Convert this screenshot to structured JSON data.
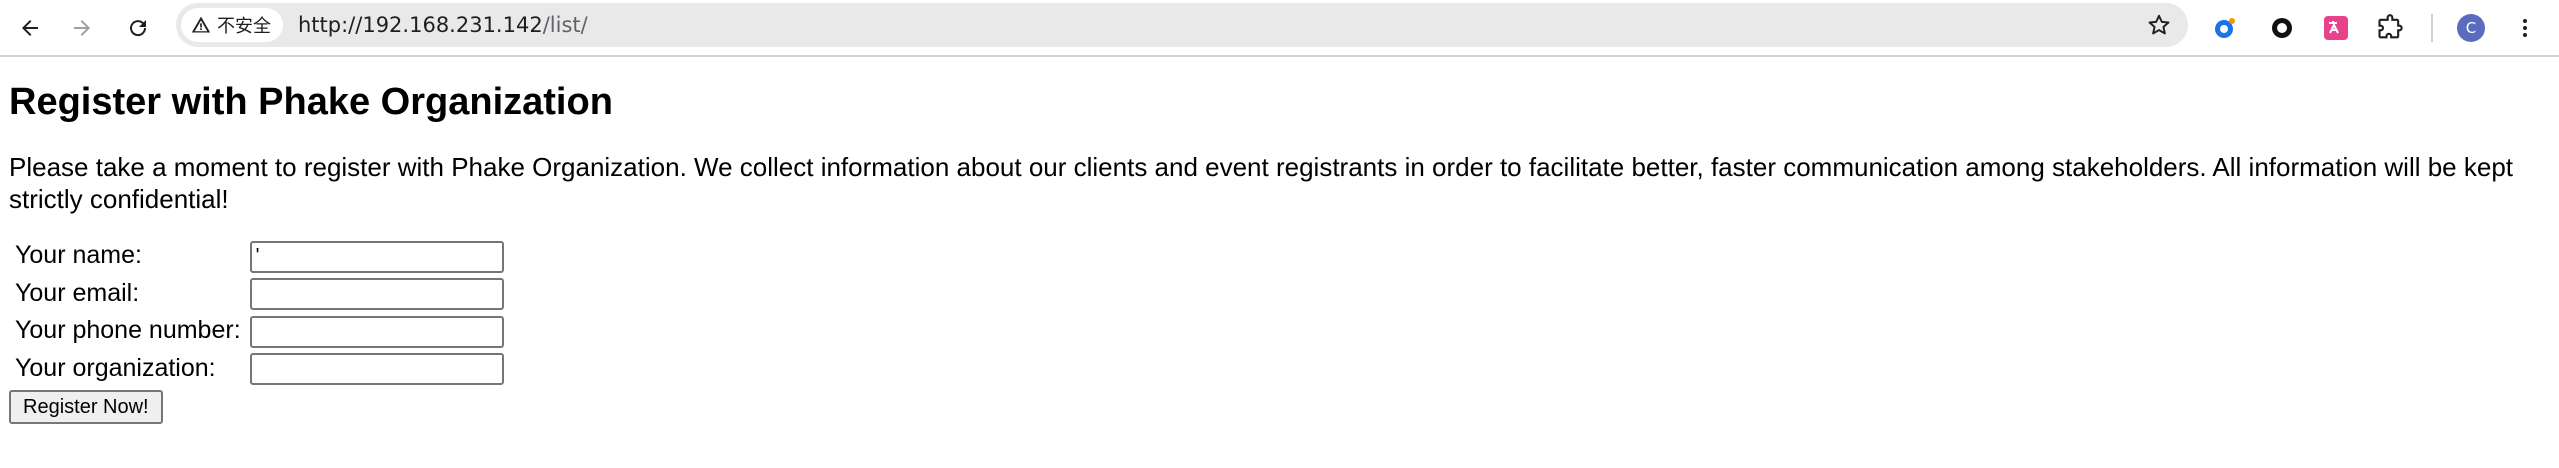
{
  "browser": {
    "security_label": "不安全",
    "url_host": "http://192.168.231.142",
    "url_path": "/list/",
    "profile_initial": "C"
  },
  "page": {
    "title": "Register with Phake Organization",
    "intro": "Please take a moment to register with Phake Organization. We collect information about our clients and event registrants in order to facilitate better, faster communication among stakeholders. All information will be kept strictly confidential!",
    "form": {
      "fields": [
        {
          "label": "Your name:",
          "value": "'"
        },
        {
          "label": "Your email:",
          "value": ""
        },
        {
          "label": "Your phone number:",
          "value": ""
        },
        {
          "label": "Your organization:",
          "value": ""
        }
      ],
      "submit_label": "Register Now!"
    }
  },
  "colors": {
    "toolbar_bg": "#ffffff",
    "omnibox_bg": "#e9e9e9",
    "avatar_bg": "#5b6bbf"
  }
}
